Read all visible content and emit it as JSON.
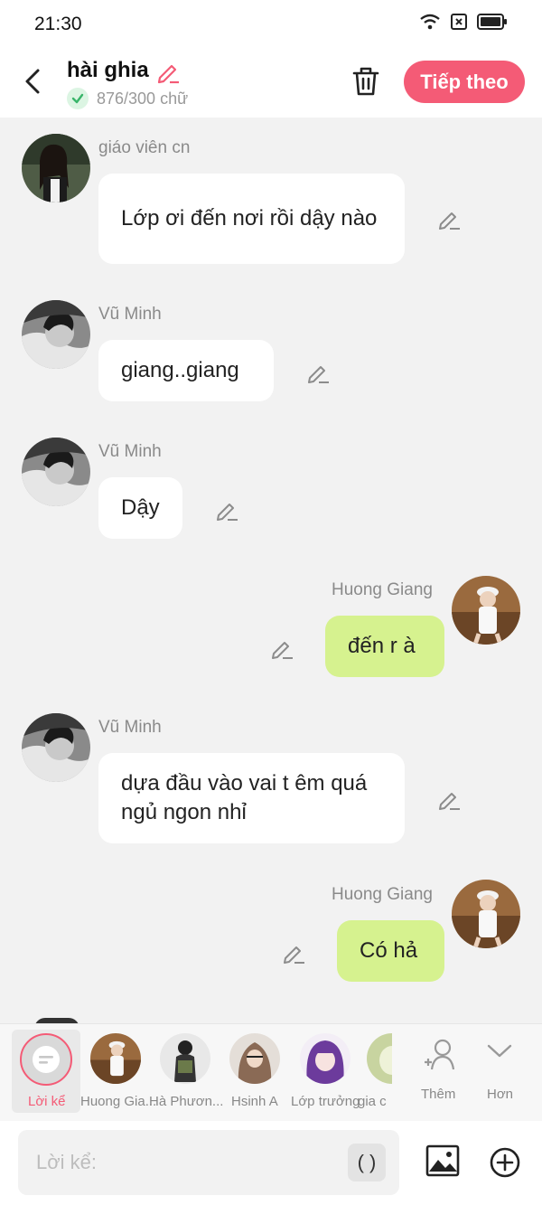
{
  "status": {
    "time": "21:30"
  },
  "header": {
    "title": "hài ghia",
    "word_count": "876/300 chữ",
    "next_label": "Tiếp theo",
    "accent": "#f45b76"
  },
  "messages": [
    {
      "sender": "giáo viên cn",
      "text": "Lớp ơi đến nơi rồi dậy nào",
      "side": "left"
    },
    {
      "sender": "Vũ Minh",
      "text": "giang..giang",
      "side": "left"
    },
    {
      "sender": "Vũ Minh",
      "text": "Dậy",
      "side": "left"
    },
    {
      "sender": "Huong Giang",
      "text": "đến r à",
      "side": "right"
    },
    {
      "sender": "Vũ Minh",
      "text": "dựa đầu vào vai t êm quá ngủ ngon nhỉ",
      "side": "left"
    },
    {
      "sender": "Huong Giang",
      "text": "Có hả",
      "side": "right"
    }
  ],
  "tray": {
    "narrator_label": "Lời kể",
    "characters": [
      "Huong Gia...",
      "Hà Phươn...",
      "Hsinh A",
      "Lớp trưởng",
      "gia c"
    ],
    "add_label": "Thêm",
    "more_label": "Hơn"
  },
  "composer": {
    "placeholder": "Lời kể:",
    "paren_label": "( )"
  }
}
